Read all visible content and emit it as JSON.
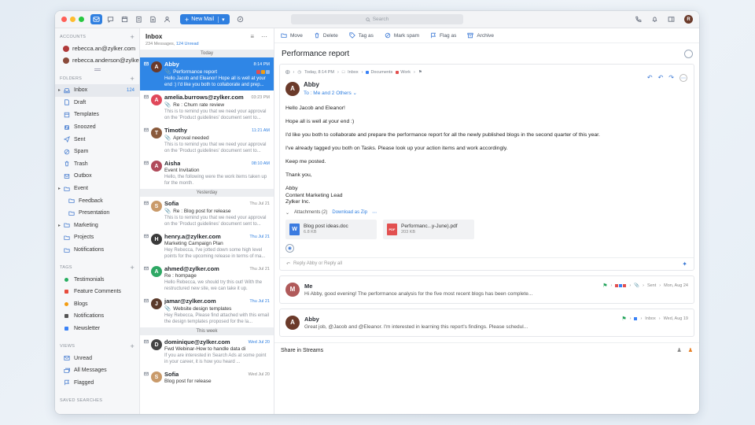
{
  "colors": {
    "accent": "#2f7fe0",
    "selected": "#2f86e6",
    "dot_red": "#ff5f57",
    "dot_yellow": "#febc2e",
    "dot_green": "#28c840"
  },
  "titlebar": {
    "new_mail": "New Mail",
    "search_placeholder": "Search"
  },
  "sidebar": {
    "accounts_title": "ACCOUNTS",
    "accounts": [
      "rebecca.an@zylker.com",
      "rebecca.anderson@zylker..."
    ],
    "folders_title": "FOLDERS",
    "folders": [
      {
        "label": "Inbox",
        "count": "124",
        "icon": "inbox-icon",
        "chev": true,
        "active": true
      },
      {
        "label": "Draft",
        "icon": "draft-icon"
      },
      {
        "label": "Templates",
        "icon": "templates-icon"
      },
      {
        "label": "Snoozed",
        "icon": "snoozed-icon"
      },
      {
        "label": "Sent",
        "icon": "sent-icon"
      },
      {
        "label": "Spam",
        "icon": "spam-icon"
      },
      {
        "label": "Trash",
        "icon": "trash-icon"
      },
      {
        "label": "Outbox",
        "icon": "outbox-icon"
      },
      {
        "label": "Event",
        "icon": "folder-icon",
        "chev": true
      },
      {
        "label": "Feedback",
        "icon": "folder-icon",
        "sub": true
      },
      {
        "label": "Presentation",
        "icon": "folder-icon",
        "sub": true
      },
      {
        "label": "Marketing",
        "icon": "folder-icon",
        "chev": true
      },
      {
        "label": "Projects",
        "icon": "folder-icon"
      },
      {
        "label": "Notifications",
        "icon": "folder-icon"
      }
    ],
    "tags_title": "TAGS",
    "tags": [
      {
        "label": "Testimonials",
        "color": "#27ae60",
        "shape": "dot"
      },
      {
        "label": "Feature Comments",
        "color": "#e74c3c",
        "shape": "sq"
      },
      {
        "label": "Blogs",
        "color": "#f39c12",
        "shape": "dot"
      },
      {
        "label": "Notifications",
        "color": "#555555",
        "shape": "sq"
      },
      {
        "label": "Newsletter",
        "color": "#3b82f6",
        "shape": "sq"
      }
    ],
    "views_title": "VIEWS",
    "views": [
      {
        "label": "Unread",
        "icon": "unread-icon"
      },
      {
        "label": "All Messages",
        "icon": "all-messages-icon"
      },
      {
        "label": "Flagged",
        "icon": "flagged-icon"
      }
    ],
    "saved_title": "SAVED SEARCHES"
  },
  "msglist": {
    "title": "Inbox",
    "count_text": "234 Messages,",
    "unread_text": "124 Unread",
    "sections": [
      {
        "label": "Today",
        "messages": [
          {
            "from": "Abby",
            "time": "8:14 PM",
            "subject": "Performance report",
            "clip": true,
            "preview": "Hello Jacob and Eleanor! Hope all is well at your end :) I'd like you both to collaborate and prep...",
            "avatar_color": "#6b3a2a",
            "avatar_letter": "A",
            "selected": true
          },
          {
            "from": "amelia.burrows@zylker.com",
            "time": "03:23 PM",
            "subject": "Re : Churn rate review",
            "clip": true,
            "preview": "This is to remind you that we need your approval on the 'Product guidelines' document sent to...",
            "avatar_color": "#e0485a",
            "avatar_letter": "A"
          },
          {
            "from": "Timothy",
            "time": "11:21 AM",
            "time_blue": true,
            "subject": "Aproval needed",
            "clip": true,
            "preview": "This is to remind you that we need your approval on the 'Product guidelines' document sent to...",
            "avatar_color": "#8a5a3c",
            "avatar_letter": "T"
          },
          {
            "from": "Aisha",
            "time": "08:10 AM",
            "time_blue": true,
            "subject": "Event Invitation",
            "preview": "Hello, the following were the work items taken up for the month.",
            "avatar_color": "#b04a5a",
            "avatar_letter": "A"
          }
        ]
      },
      {
        "label": "Yesterday",
        "messages": [
          {
            "from": "Sofia",
            "time": "Thu Jul 21",
            "subject": "Re : Blog post for release",
            "clip": true,
            "preview": "This is to remind you that we need your approval on the 'Product guidelines' document sent to...",
            "avatar_color": "#c99a6a",
            "avatar_letter": "S",
            "light": true
          },
          {
            "from": "henry.a@zylker.com",
            "time": "Thu Jul 21",
            "time_blue": true,
            "subject": "Marketing Campaign Plan",
            "preview": "Hey Rebecca, I've jotted down some high level points for the upcoming release in terms of ma...",
            "avatar_color": "#3a3a3a",
            "avatar_letter": "H"
          },
          {
            "from": "ahmed@zylker.com",
            "time": "Thu Jul 21",
            "subject": "Re : hompage",
            "preview": "Hello Rebecca, we should try this out! With the restructured new site, we can take it up.",
            "avatar_color": "#2ea864",
            "avatar_letter": "A"
          },
          {
            "from": "jamar@zylker.com",
            "time": "Thu Jul 21",
            "time_blue": true,
            "subject": "Website design templates",
            "clip": true,
            "preview": "Hey Rebecca, Please find attached with this email the design templates proposed for the la...",
            "avatar_color": "#5a3a2a",
            "avatar_letter": "J"
          }
        ]
      },
      {
        "label": "This week",
        "messages": [
          {
            "from": "dominique@zylker.com",
            "time": "Wed Jul 20",
            "time_blue": true,
            "subject": "Fwd Webinar-How to handle data di",
            "preview": "If you are interested in Search Ads at some point in your career, it is how you heard ...",
            "avatar_color": "#444444",
            "avatar_letter": "D"
          },
          {
            "from": "Sofia",
            "time": "Wed Jul 20",
            "subject": "Blog post for release",
            "preview": "",
            "avatar_color": "#c99a6a",
            "avatar_letter": "S",
            "light": true
          }
        ]
      }
    ]
  },
  "toolbar": [
    {
      "label": "Move",
      "icon": "move-icon"
    },
    {
      "label": "Delete",
      "icon": "delete-icon"
    },
    {
      "label": "Tag as",
      "icon": "tag-icon"
    },
    {
      "label": "Mark spam",
      "icon": "spam-icon"
    },
    {
      "label": "Flag as",
      "icon": "flag-icon"
    },
    {
      "label": "Archive",
      "icon": "archive-icon"
    }
  ],
  "reader": {
    "subject": "Performance report",
    "meta_time": "Today, 8:14 PM",
    "meta_folder": "Inbox",
    "meta_tag1": "Documents",
    "meta_tag2": "Work",
    "sender": "Abby",
    "to": "To : Me and 2 Others",
    "body": [
      "Hello Jacob and Eleanor!",
      "Hope all is well at your end :)",
      "I'd like you both to collaborate and prepare the performance report for all the newly published blogs in the second quarter of this year.",
      "I've already tagged you both on Tasks. Please look up your action items and work accordingly.",
      "Keep me posted."
    ],
    "signoff": [
      "Thank you,"
    ],
    "signature": [
      "Abby",
      "Content Marketing Lead",
      "Zylker Inc."
    ],
    "attachments_label": "Attachments (2)",
    "download_zip": "Download as Zip",
    "attachments": [
      {
        "name": "Blog post ideas.doc",
        "size": "6.8 KB",
        "type": "W",
        "color": "#3b7be0"
      },
      {
        "name": "Performanc...y-June).pdf",
        "size": "203 KB",
        "type": "PDF",
        "color": "#e25050"
      }
    ],
    "reply_placeholder": "Reply Abby or Reply all"
  },
  "threads": [
    {
      "name": "Me",
      "preview": "Hi Abby, good evening! The performance analysis for the five most recent blogs has been complete...",
      "meta_folder": "Sent",
      "meta_date": "Mon, Aug 24",
      "avatar_color": "#b05a5a",
      "avatar_letter": "M"
    },
    {
      "name": "Abby",
      "preview": "Great job, @Jacob and @Eleanor. I'm interested in learning this report's findings. Please schedul...",
      "meta_folder": "Inbox",
      "meta_date": "Wed, Aug 19",
      "avatar_color": "#6b3a2a",
      "avatar_letter": "A"
    }
  ],
  "streams_label": "Share in Streams"
}
